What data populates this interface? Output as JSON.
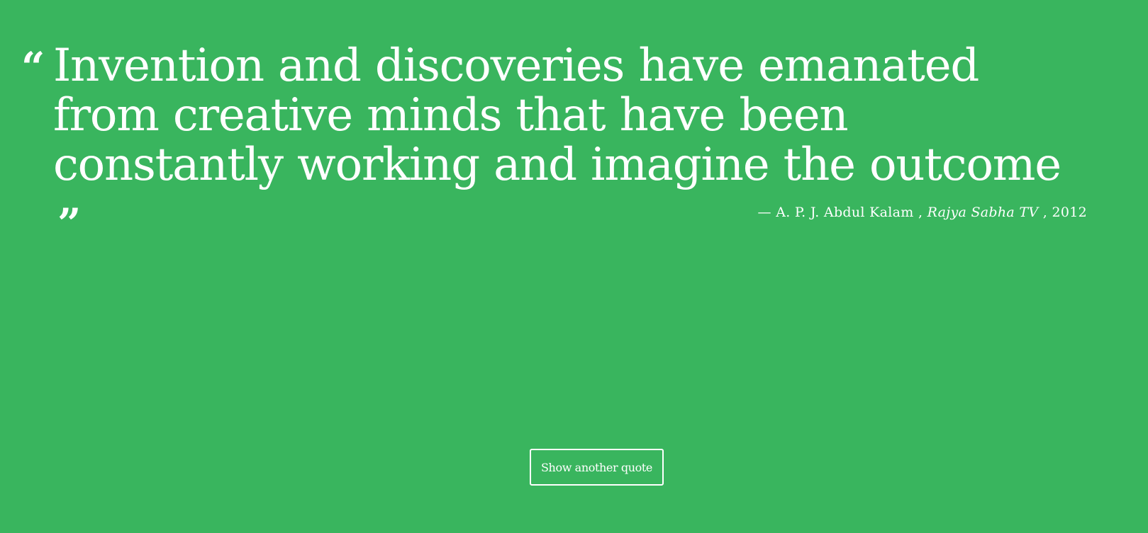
{
  "colors": {
    "background": "#39b55e",
    "text": "#ffffff"
  },
  "quote": {
    "open_mark": "“",
    "text": "Invention and discoveries have emanated from creative minds that have been constantly working and imagine the outcome",
    "close_mark": "”"
  },
  "attribution": {
    "dash": "—",
    "author": "A. P. J. Abdul Kalam",
    "separator1": ",",
    "source": "Rajya Sabha TV",
    "separator2": ",",
    "year": "2012"
  },
  "button": {
    "label": "Show another quote"
  }
}
